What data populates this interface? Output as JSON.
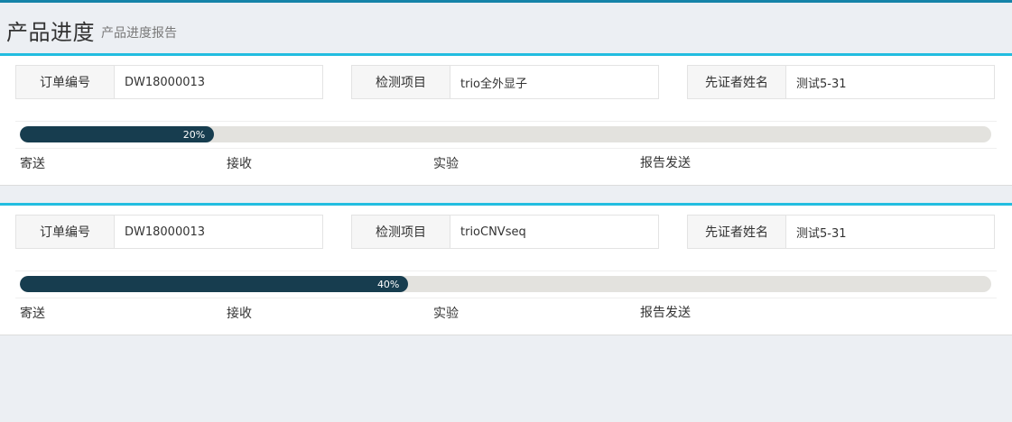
{
  "header": {
    "title": "产品进度",
    "subtitle": "产品进度报告"
  },
  "labels": {
    "order_no": "订单编号",
    "test_item": "检测项目",
    "proband_name": "先证者姓名"
  },
  "orders": [
    {
      "order_no": "DW18000013",
      "test_item": "trio全外显子",
      "proband_name": "测试5-31",
      "progress_percent": 20,
      "progress_label": "20%",
      "steps": [
        "寄送",
        "接收",
        "实验",
        "报告发送"
      ]
    },
    {
      "order_no": "DW18000013",
      "test_item": "trioCNVseq",
      "proband_name": "测试5-31",
      "progress_percent": 40,
      "progress_label": "40%",
      "steps": [
        "寄送",
        "接收",
        "实验",
        "报告发送"
      ]
    }
  ],
  "colors": {
    "accent": "#22bde0",
    "progress_fill": "#173d4f",
    "progress_track": "#e3e2de"
  }
}
